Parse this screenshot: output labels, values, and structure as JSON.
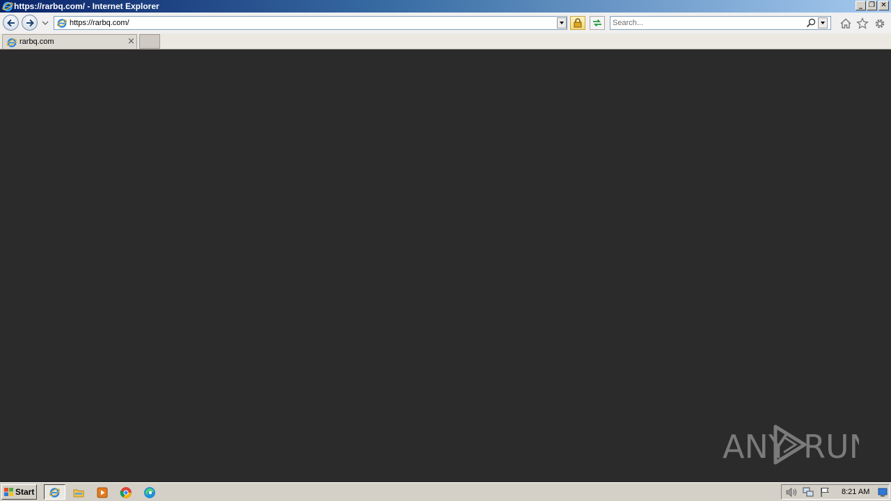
{
  "window": {
    "title": "https://rarbq.com/ - Internet Explorer",
    "controls": {
      "minimize": "_",
      "restore": "❐",
      "close": "✕"
    }
  },
  "toolbar": {
    "address": "https://rarbq.com/",
    "search_placeholder": "Search..."
  },
  "tabs": [
    {
      "label": "rarbq.com",
      "close": "×"
    }
  ],
  "watermark": {
    "left": "ANY",
    "right": "RUN"
  },
  "taskbar": {
    "start_label": "Start",
    "pinned": [
      "internet-explorer",
      "file-explorer",
      "media-player",
      "chrome",
      "edge"
    ],
    "clock": "8:21 AM"
  },
  "colors": {
    "content_bg": "#2b2b2b",
    "title_bar_start": "#0a246a",
    "title_bar_end": "#a6caf0",
    "chrome_bg": "#f0f0f0",
    "taskbar_bg": "#d4d0c8"
  }
}
